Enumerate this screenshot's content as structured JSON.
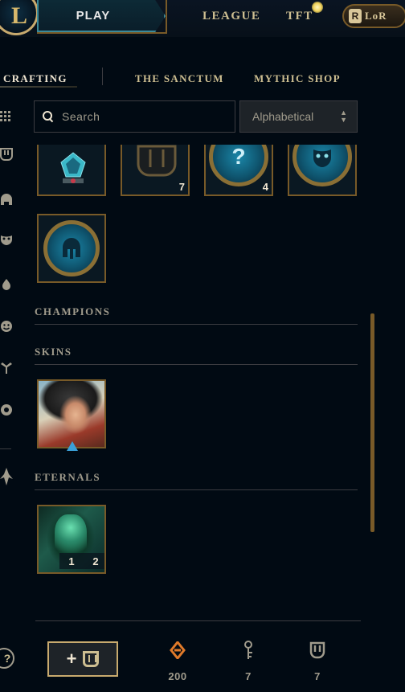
{
  "topbar": {
    "logo_letter": "L",
    "play_label": "PLAY",
    "league_label": "LEAGUE",
    "tft_label": "TFT",
    "lor_label": "LoR",
    "lor_icon_letter": "R"
  },
  "subnav": {
    "crafting_label": "CRAFTING",
    "sanctum_label": "THE SANCTUM",
    "mythic_label": "MYTHIC SHOP"
  },
  "search": {
    "placeholder": "Search",
    "value": ""
  },
  "sort": {
    "selected": "Alphabetical",
    "arrows_up": "▲",
    "arrows_down": "▼"
  },
  "rail_icons": [
    "grid-icon",
    "chest-icon",
    "champion-icon",
    "mask-icon",
    "ward-icon",
    "emote-icon",
    "sprite-icon",
    "icon-icon",
    "eternals-icon"
  ],
  "top_tiles": [
    {
      "name": "hextech-crystal",
      "count": ""
    },
    {
      "name": "chest",
      "count": "7"
    },
    {
      "name": "mystery-emblem",
      "count": "4",
      "glyph": "?"
    },
    {
      "name": "mask-emblem",
      "count": ""
    }
  ],
  "helm_tile": {
    "name": "helm-emblem"
  },
  "sections": {
    "champions": "CHAMPIONS",
    "skins": "SKINS",
    "eternals": "ETERNALS"
  },
  "eternal_tile": {
    "badge1": "1",
    "badge2": "2"
  },
  "footer": {
    "help_label": "?",
    "add_label": "+",
    "currencies": [
      {
        "name": "orange-essence",
        "icon": "orange-essence-icon",
        "value": "200",
        "color": "#e07a2a"
      },
      {
        "name": "key",
        "icon": "key-icon",
        "value": "7",
        "color": "#a09b8c"
      },
      {
        "name": "chest",
        "icon": "chest-icon",
        "value": "7",
        "color": "#a09b8c"
      }
    ]
  },
  "colors": {
    "gold": "#c8aa6e",
    "background": "#010a13",
    "teal": "#1a86a8"
  }
}
